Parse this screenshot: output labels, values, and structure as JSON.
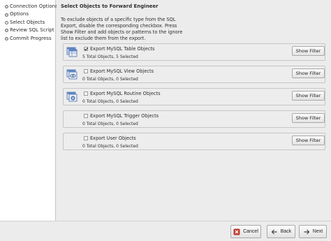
{
  "sidebar": {
    "steps": [
      {
        "label": "Connection Options"
      },
      {
        "label": "Options"
      },
      {
        "label": "Select Objects"
      },
      {
        "label": "Review SQL Script"
      },
      {
        "label": "Commit Progress"
      }
    ]
  },
  "main": {
    "title": "Select Objects to Forward Engineer",
    "description": "To exclude objects of a specific type from the SQL Export, disable the corresponding checkbox. Press Show Filter and add objects or patterns to the ignore list to exclude them from the export.",
    "objects": [
      {
        "label": "Export MySQL Table Objects",
        "checked": true,
        "count": "5 Total Objects, 5 Selected",
        "filter_label": "Show Filter",
        "icon": "table-objects-icon"
      },
      {
        "label": "Export MySQL View Objects",
        "checked": false,
        "count": "0 Total Objects, 0 Selected",
        "filter_label": "Show Filter",
        "icon": "view-objects-icon"
      },
      {
        "label": "Export MySQL Routine Objects",
        "checked": false,
        "count": "0 Total Objects, 0 Selected",
        "filter_label": "Show Filter",
        "icon": "routine-objects-icon"
      },
      {
        "label": "Export MySQL Trigger Objects",
        "checked": false,
        "count": "0 Total Objects, 0 Selected",
        "filter_label": "Show Filter",
        "icon": "none"
      },
      {
        "label": "Export User Objects",
        "checked": false,
        "count": "0 Total Objects, 0 Selected",
        "filter_label": "Show Filter",
        "icon": "none"
      }
    ]
  },
  "footer": {
    "cancel_label": "Cancel",
    "back_label": "Back",
    "next_label": "Next"
  },
  "colors": {
    "background": "#ececec",
    "sidebar": "#ffffff",
    "cancel_icon": "#c0392b"
  }
}
